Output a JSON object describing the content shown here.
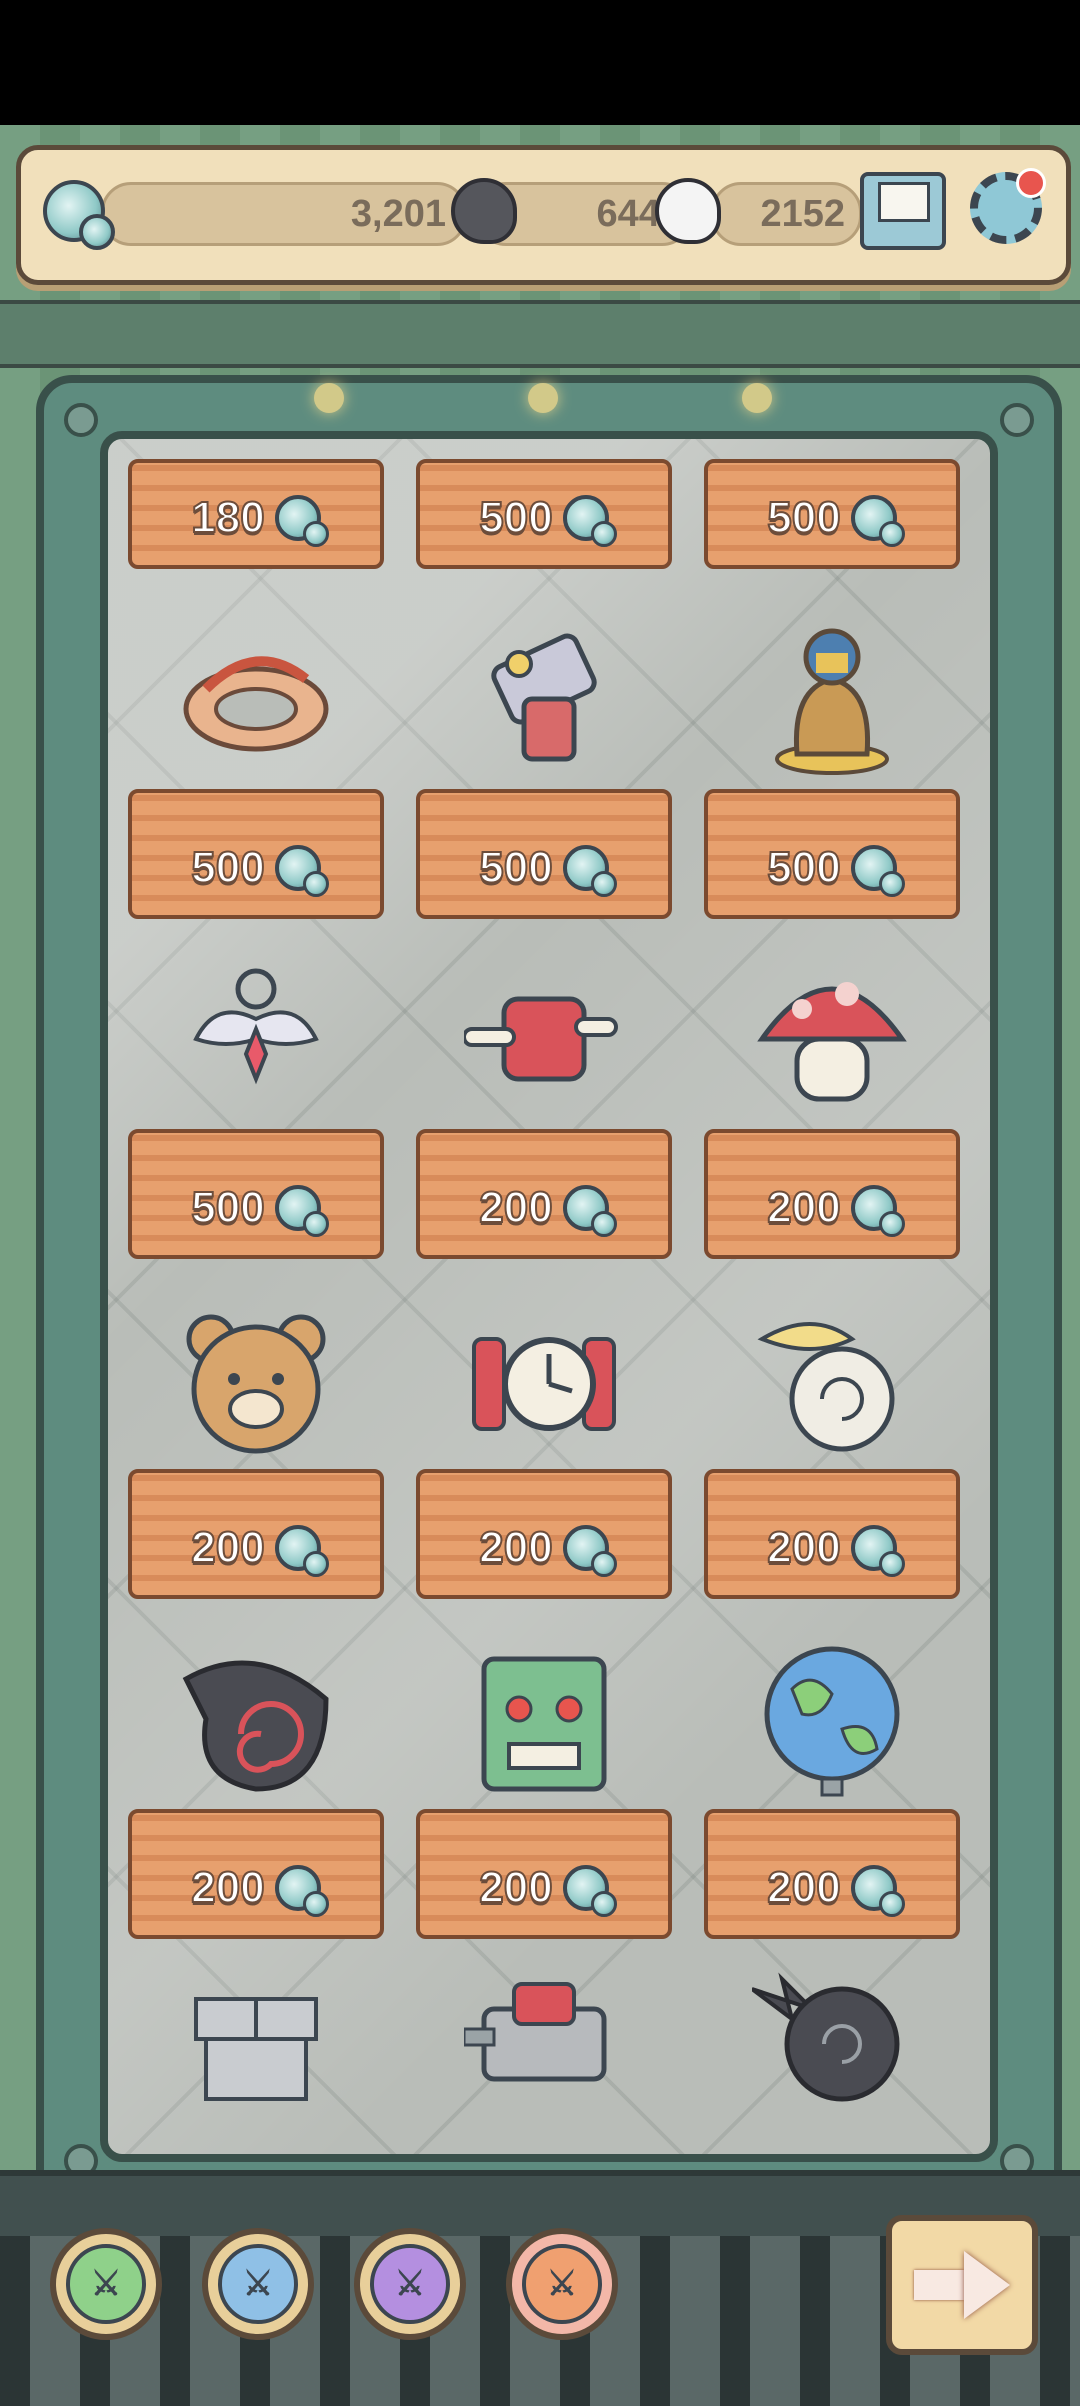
{
  "currencies": {
    "orbs": "3,201",
    "dark_souls": "6445",
    "light_souls": "2152"
  },
  "icons": {
    "orb": "orb-currency-icon",
    "dark_soul": "dark-soul-icon",
    "light_soul": "light-soul-icon",
    "mail": "mail-icon",
    "settings": "gear-icon",
    "next": "arrow-right-icon"
  },
  "shop": {
    "items": [
      {
        "name": "item-top-1",
        "price": "180"
      },
      {
        "name": "item-top-2",
        "price": "500"
      },
      {
        "name": "item-top-3",
        "price": "500"
      },
      {
        "name": "coiled-dragon-ring",
        "price": "500"
      },
      {
        "name": "cannon-gauntlet",
        "price": "500"
      },
      {
        "name": "golden-pharaoh-urn",
        "price": "500"
      },
      {
        "name": "winged-pendant",
        "price": "500"
      },
      {
        "name": "meat-on-bone",
        "price": "200"
      },
      {
        "name": "red-mushroom",
        "price": "200"
      },
      {
        "name": "teddy-bear-head",
        "price": "200"
      },
      {
        "name": "dynamite-clock-bomb",
        "price": "200"
      },
      {
        "name": "winged-shell",
        "price": "200"
      },
      {
        "name": "spiral-horn-shell",
        "price": "200"
      },
      {
        "name": "green-demon-totem",
        "price": "200"
      },
      {
        "name": "world-globe",
        "price": "200"
      },
      {
        "name": "stone-brick-pile",
        "price": ""
      },
      {
        "name": "mechanical-turret",
        "price": ""
      },
      {
        "name": "bat-wing-shell",
        "price": ""
      }
    ]
  },
  "tabs": [
    {
      "name": "tab-green-sword",
      "color": "#8fd18a"
    },
    {
      "name": "tab-blue-sword",
      "color": "#8fc0e6"
    },
    {
      "name": "tab-purple-sword",
      "color": "#b48fe0"
    },
    {
      "name": "tab-orange-sword",
      "color": "#f0a070"
    }
  ],
  "colors": {
    "topbar_bg": "#f1e0bb",
    "frame": "#5e8c7f",
    "pedestal": "#e7a06e",
    "notification": "#e8554e"
  }
}
